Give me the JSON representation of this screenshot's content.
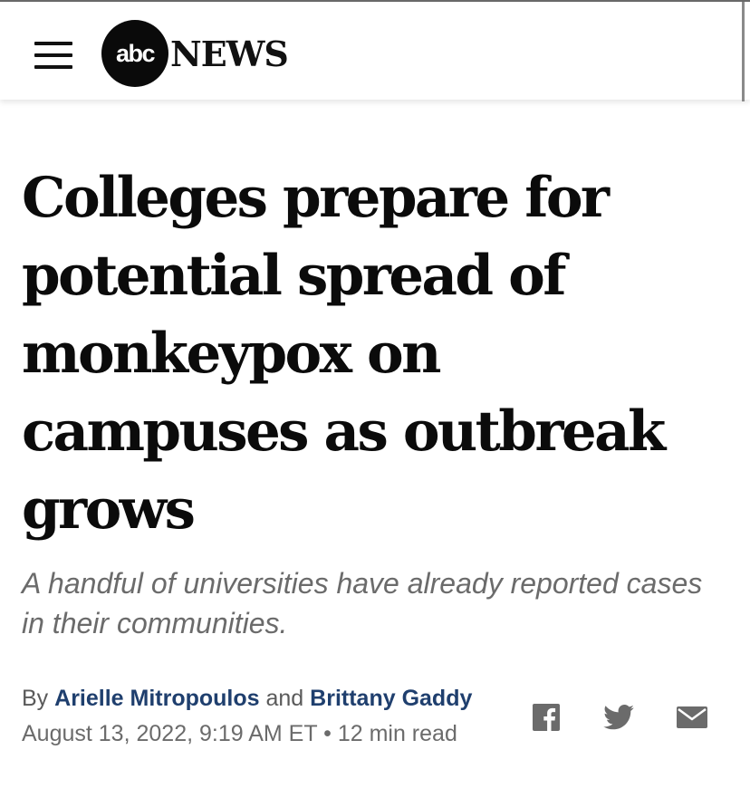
{
  "header": {
    "logo_mark": "abc",
    "logo_wordmark": "NEWS"
  },
  "article": {
    "headline": "Colleges prepare for potential spread of monkeypox on campuses as outbreak grows",
    "subheadline": "A handful of universities have already reported cases in their communities.",
    "byline": {
      "prefix": "By",
      "author1": "Arielle Mitropoulos",
      "conjunction": "and",
      "author2": "Brittany Gaddy"
    },
    "date": "August 13, 2022, 9:19 AM ET",
    "separator": "•",
    "read_time": "12 min read"
  },
  "share": {
    "icons": [
      "facebook-icon",
      "twitter-icon",
      "email-icon"
    ],
    "icon_color": "#6b6b6b"
  },
  "colors": {
    "author_link": "#1f3f6e",
    "headline": "#0b0b0b",
    "subheadline": "#6b6b6b"
  }
}
